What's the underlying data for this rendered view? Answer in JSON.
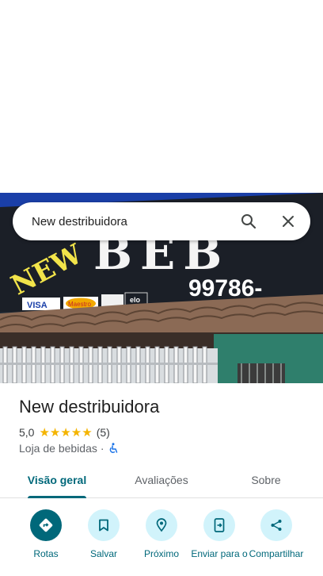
{
  "search": {
    "query": "New destribuidora"
  },
  "photo": {
    "sign_text_1": "NEW",
    "sign_text_2": "BEB",
    "phone_text": "99786-",
    "card_brands": [
      "VISA",
      "Maestro",
      "elo"
    ]
  },
  "place": {
    "name": "New destribuidora",
    "rating": "5,0",
    "stars": "★★★★★",
    "review_count": "(5)",
    "category": "Loja de bebidas",
    "separator": "·"
  },
  "tabs": [
    {
      "label": "Visão geral",
      "active": true
    },
    {
      "label": "Avaliações",
      "active": false
    },
    {
      "label": "Sobre",
      "active": false
    }
  ],
  "actions": [
    {
      "label": "Rotas",
      "icon": "directions-icon"
    },
    {
      "label": "Salvar",
      "icon": "bookmark-icon"
    },
    {
      "label": "Próximo",
      "icon": "nearby-icon"
    },
    {
      "label": "Enviar para o",
      "icon": "send-to-phone-icon"
    },
    {
      "label": "Compartilhar",
      "icon": "share-icon"
    }
  ],
  "colors": {
    "accent": "#00687a",
    "action_bg": "#d1f3fb",
    "star": "#f4b400"
  }
}
